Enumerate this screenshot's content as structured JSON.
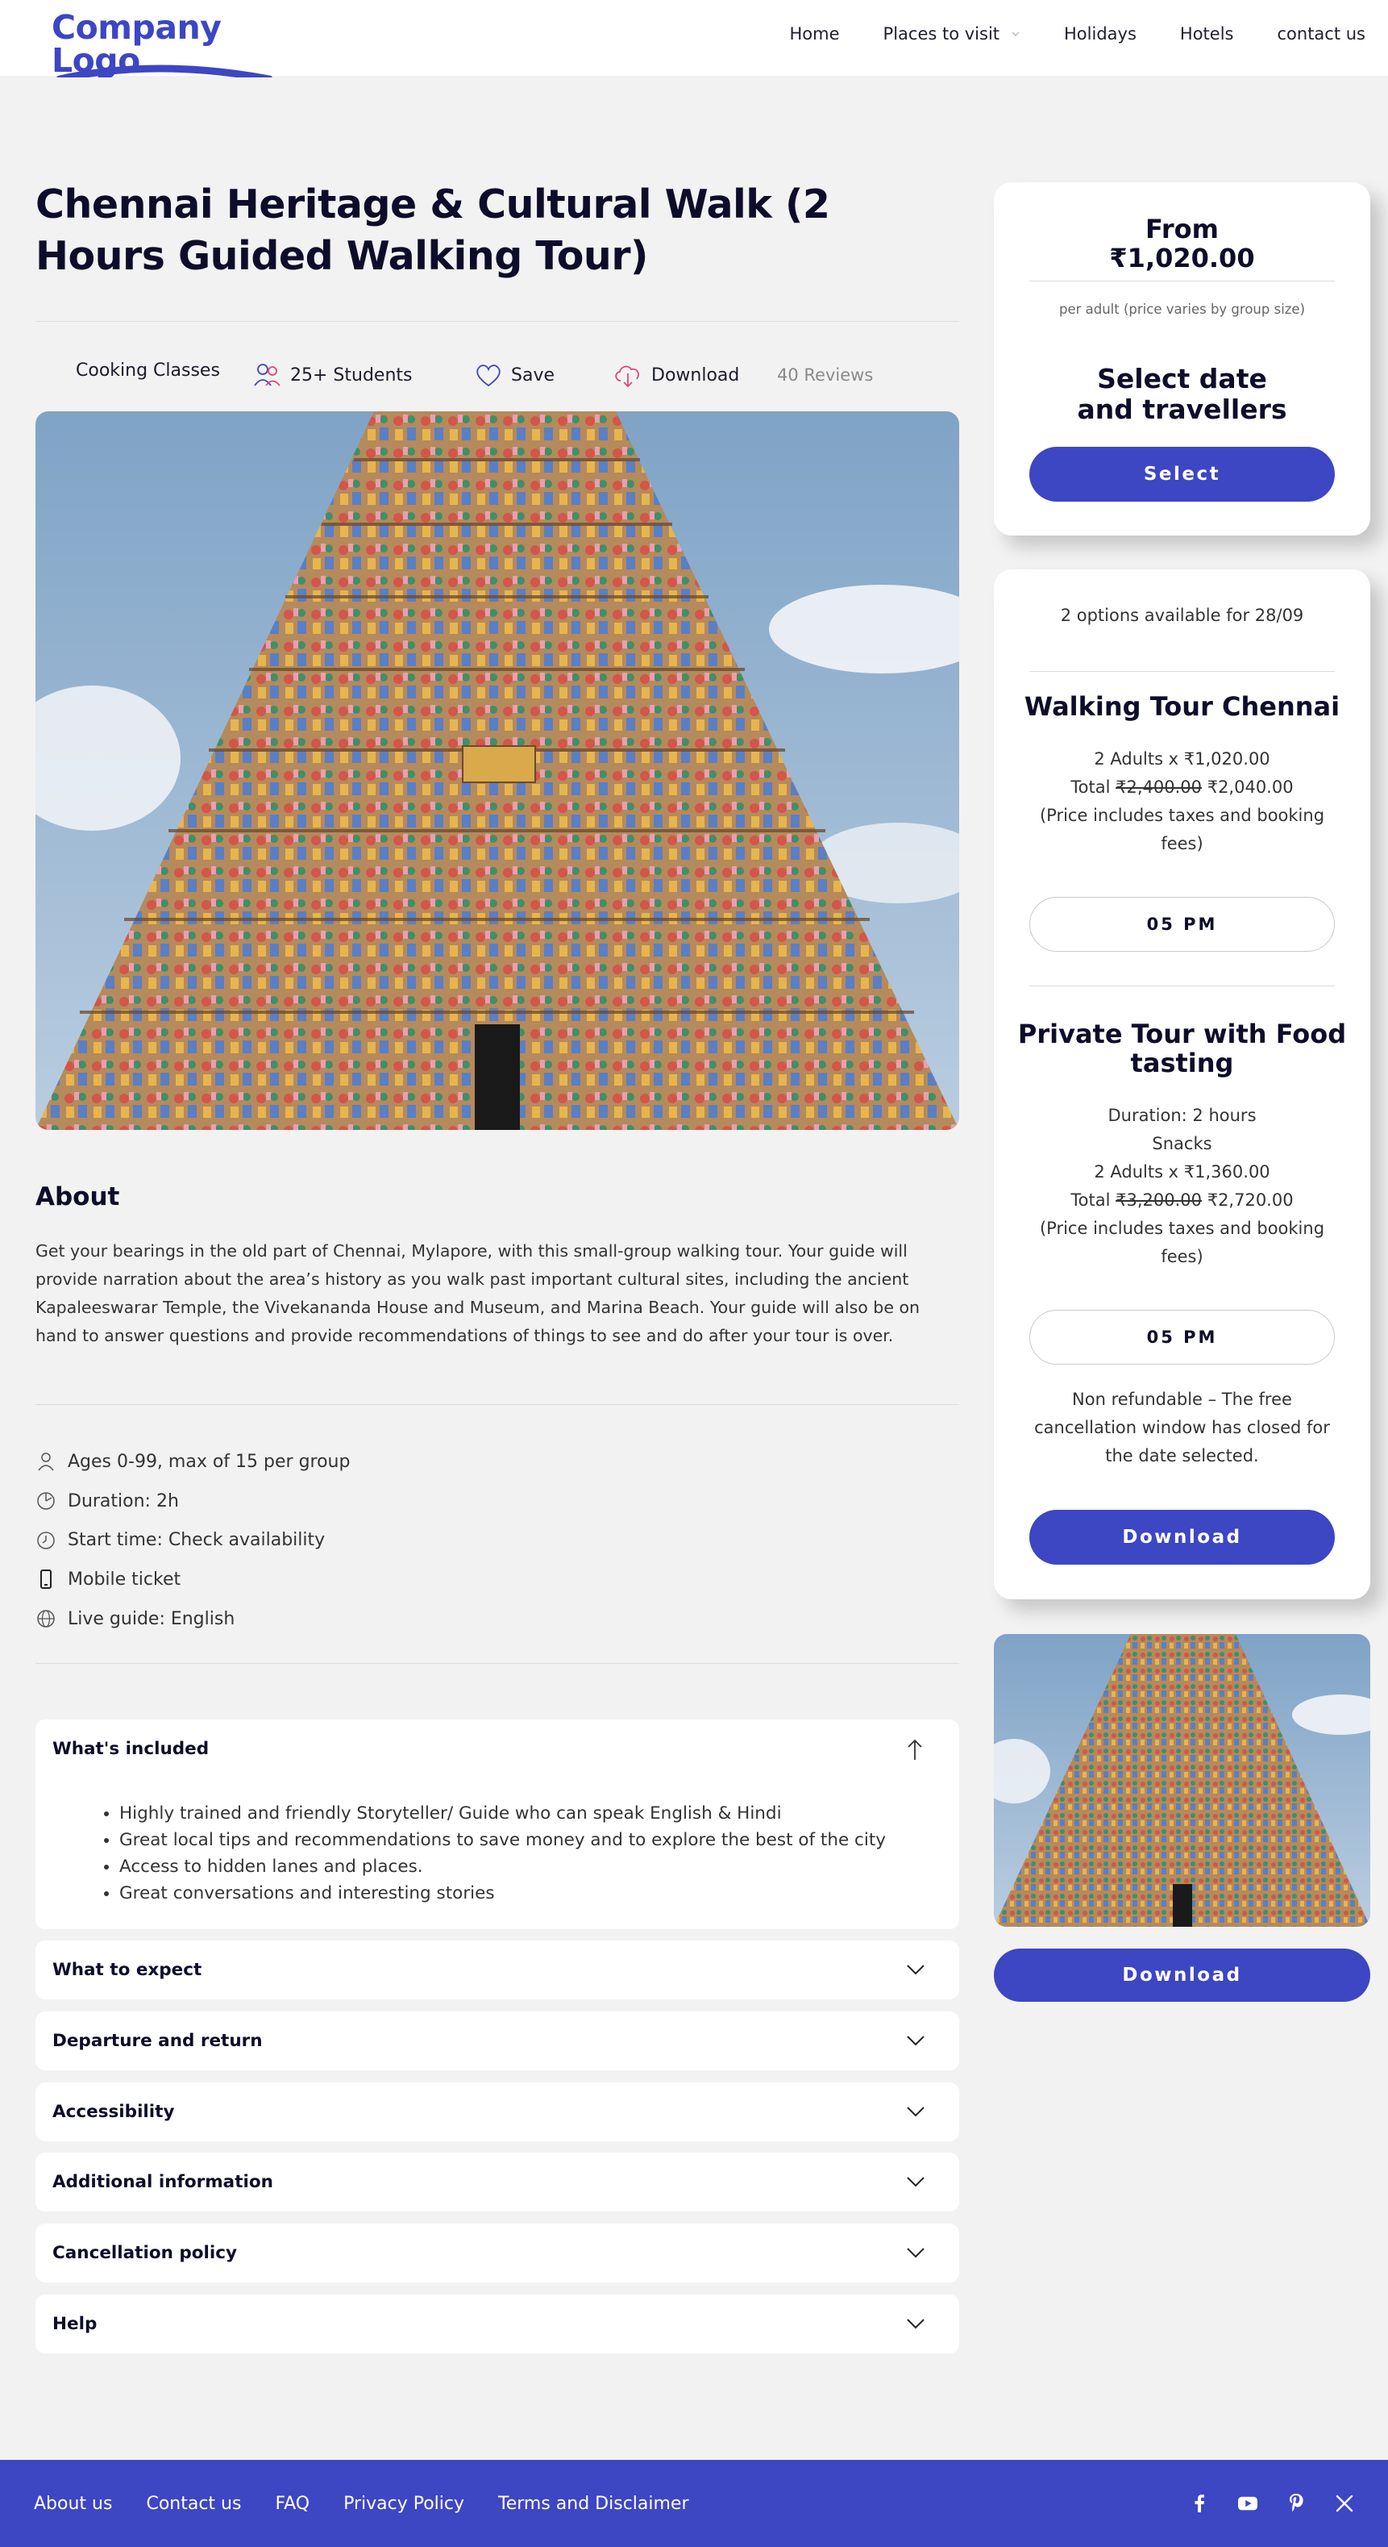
{
  "header": {
    "logo_text": "Company Logo",
    "nav": [
      "Home",
      "Places to visit",
      "Holidays",
      "Hotels",
      "contact us"
    ]
  },
  "tour": {
    "title": "Chennai Heritage & Cultural Walk (2 Hours Guided Walking Tour)",
    "meta": {
      "category": "Cooking Classes",
      "students": "25+ Students",
      "save": "Save",
      "download": "Download",
      "reviews": "40 Reviews"
    },
    "about_heading": "About",
    "about_text": "Get your bearings in the old part of Chennai, Mylapore, with this small-group walking tour. Your guide will provide narration about the area’s history as you walk past important cultural sites, including the ancient Kapaleeswarar Temple, the Vivekananda House and Museum, and Marina Beach. Your guide will also be on hand to answer questions and provide recommendations of things to see and do after your tour is over.",
    "facts": [
      {
        "icon": "person-icon",
        "text": "Ages 0-99, max of 15 per group"
      },
      {
        "icon": "timer-icon",
        "text": "Duration: 2h"
      },
      {
        "icon": "clock-icon",
        "text": "Start time: Check availability"
      },
      {
        "icon": "mobile-icon",
        "text": "Mobile ticket"
      },
      {
        "icon": "globe-icon",
        "text": "Live guide: English"
      }
    ],
    "included": {
      "title": "What's included",
      "items": [
        "Highly trained and friendly Storyteller/ Guide who can speak English & Hindi",
        "Great local tips and recommendations to save money and to explore the best of the city",
        "Access to hidden lanes and places.",
        "Great conversations and interesting stories"
      ]
    },
    "accordions": [
      "What to expect",
      "Departure and return",
      "Accessibility",
      "Additional information",
      "Cancellation policy",
      "Help"
    ]
  },
  "booking": {
    "from_label": "From",
    "from_price": "₹1,020.00",
    "price_note": "per adult (price varies by group size)",
    "select_heading_1": "Select date",
    "select_heading_2": "and travellers",
    "select_button": "Select"
  },
  "options": {
    "available": "2 options available for 28/09",
    "option1": {
      "title": "Walking Tour Chennai",
      "line1": "2 Adults x ₹1,020.00",
      "total_label": "Total",
      "old_price": "₹2,400.00",
      "new_price": "₹2,040.00",
      "tax_note": "(Price includes taxes and booking fees)",
      "time": "05 PM"
    },
    "option2": {
      "title": "Private Tour with Food tasting",
      "duration": "Duration: 2 hours",
      "snacks": "Snacks",
      "line1": "2 Adults x ₹1,360.00",
      "total_label": "Total",
      "old_price": "₹3,200.00",
      "new_price": "₹2,720.00",
      "tax_note": "(Price includes taxes and booking fees)",
      "time": "05 PM"
    },
    "refund_note": "Non refundable – The free cancellation window has closed for the date selected.",
    "download_button": "Download"
  },
  "sidebar": {
    "download_button": "Download"
  },
  "footer": {
    "links": [
      "About us",
      "Contact us",
      "FAQ",
      "Privacy Policy",
      "Terms and Disclaimer"
    ],
    "socials": [
      "facebook-icon",
      "youtube-icon",
      "pinterest-icon",
      "x-icon"
    ]
  },
  "colors": {
    "brand": "#3d46c3",
    "heading": "#0d0d2b",
    "background": "#f2f2f2"
  }
}
